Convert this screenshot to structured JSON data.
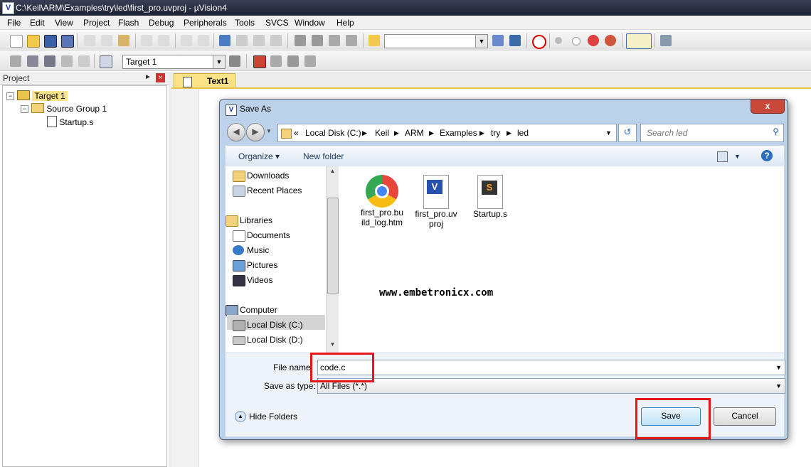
{
  "window": {
    "title": "C:\\Keil\\ARM\\Examples\\try\\led\\first_pro.uvproj - µVision4"
  },
  "menu": [
    "File",
    "Edit",
    "View",
    "Project",
    "Flash",
    "Debug",
    "Peripherals",
    "Tools",
    "SVCS",
    "Window",
    "Help"
  ],
  "toolbar": {
    "target_select": "Target 1"
  },
  "project_panel": {
    "header": "Project",
    "tree": [
      {
        "label": "Target 1"
      },
      {
        "label": "Source Group 1"
      },
      {
        "label": "Startup.s"
      }
    ]
  },
  "editor": {
    "tab": "Text1"
  },
  "dialog": {
    "title": "Save As",
    "close_label": "x",
    "breadcrumb": [
      "«",
      "Local Disk (C:)",
      "Keil",
      "ARM",
      "Examples",
      "try",
      "led"
    ],
    "search_placeholder": "Search led",
    "organize": "Organize ▾",
    "new_folder": "New folder",
    "nav_items": [
      {
        "label": "Downloads"
      },
      {
        "label": "Recent Places"
      },
      {
        "label": "Libraries"
      },
      {
        "label": "Documents"
      },
      {
        "label": "Music"
      },
      {
        "label": "Pictures"
      },
      {
        "label": "Videos"
      },
      {
        "label": "Computer"
      },
      {
        "label": "Local Disk (C:)"
      },
      {
        "label": "Local Disk (D:)"
      }
    ],
    "files": [
      {
        "name_l1": "first_pro.bu",
        "name_l2": "ild_log.htm",
        "icon": "chrome-icon"
      },
      {
        "name_l1": "first_pro.uv",
        "name_l2": "proj",
        "icon": "uvision-project-icon"
      },
      {
        "name_l1": "Startup.s",
        "name_l2": "",
        "icon": "assembly-file-icon"
      }
    ],
    "watermark": "www.embetronicx.com",
    "file_name_label": "File name:",
    "file_name_value": "code.c",
    "save_type_label": "Save as type:",
    "save_type_value": "All Files (*.*)",
    "hide_folders": "Hide Folders",
    "save_button": "Save",
    "cancel_button": "Cancel"
  },
  "colors": {
    "highlight": "#e4141b",
    "title_bar": "#2a2f44",
    "dialog_frame": "#bcd2ea",
    "tab_active": "#fbe38a"
  }
}
